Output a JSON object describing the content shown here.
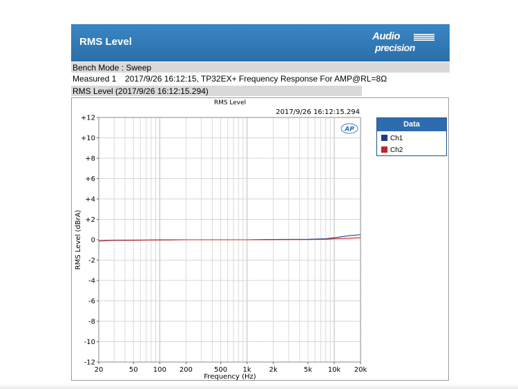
{
  "header": {
    "title": "RMS Level",
    "logo_top": "Audio",
    "logo_bottom": "precision"
  },
  "bench_mode": "Bench Mode : Sweep",
  "measured": {
    "label": "Measured 1",
    "text": "2017/9/26 16:12:15, TP32EX+ Frequency Response For AMP@RL=8Ω"
  },
  "rms_row": "RMS Level (2017/9/26 16:12:15.294)",
  "legend": {
    "title": "Data",
    "items": [
      "Ch1",
      "Ch2"
    ]
  },
  "colors": {
    "header_blue": "#2b6fa8",
    "ch1": "#1f3a8a",
    "ch2": "#c0242a",
    "grid": "#cfcfcf"
  },
  "chart_data": {
    "type": "line",
    "title": "RMS Level",
    "subtitle": "2017/9/26 16:12:15.294",
    "xlabel": "Frequency (Hz)",
    "ylabel": "RMS Level (dBrA)",
    "x_scale": "log",
    "xlim": [
      20,
      20000
    ],
    "ylim": [
      -12,
      12
    ],
    "grid": true,
    "x_ticks": [
      {
        "value": 20,
        "label": "20"
      },
      {
        "value": 50,
        "label": "50"
      },
      {
        "value": 100,
        "label": "100"
      },
      {
        "value": 200,
        "label": "200"
      },
      {
        "value": 500,
        "label": "500"
      },
      {
        "value": 1000,
        "label": "1k"
      },
      {
        "value": 2000,
        "label": "2k"
      },
      {
        "value": 5000,
        "label": "5k"
      },
      {
        "value": 10000,
        "label": "10k"
      },
      {
        "value": 20000,
        "label": "20k"
      }
    ],
    "y_ticks": [
      {
        "value": 12,
        "label": "+12"
      },
      {
        "value": 10,
        "label": "+10"
      },
      {
        "value": 8,
        "label": "+8"
      },
      {
        "value": 6,
        "label": "+6"
      },
      {
        "value": 4,
        "label": "+4"
      },
      {
        "value": 2,
        "label": "+2"
      },
      {
        "value": 0,
        "label": "0"
      },
      {
        "value": -2,
        "label": "-2"
      },
      {
        "value": -4,
        "label": "-4"
      },
      {
        "value": -6,
        "label": "-6"
      },
      {
        "value": -8,
        "label": "-8"
      },
      {
        "value": -10,
        "label": "-10"
      },
      {
        "value": -12,
        "label": "-12"
      }
    ],
    "series": [
      {
        "name": "Ch1",
        "color": "#1f3a8a",
        "x": [
          20,
          30,
          50,
          100,
          200,
          500,
          1000,
          2000,
          5000,
          8000,
          10000,
          15000,
          20000
        ],
        "y": [
          -0.12,
          -0.06,
          -0.05,
          -0.02,
          0.0,
          0.0,
          0.0,
          0.03,
          0.05,
          0.1,
          0.2,
          0.4,
          0.5
        ]
      },
      {
        "name": "Ch2",
        "color": "#c0242a",
        "x": [
          20,
          30,
          50,
          100,
          200,
          500,
          1000,
          2000,
          5000,
          8000,
          10000,
          15000,
          20000
        ],
        "y": [
          -0.1,
          -0.05,
          -0.04,
          -0.02,
          0.0,
          0.0,
          0.0,
          0.01,
          0.02,
          0.05,
          0.1,
          0.15,
          0.2
        ]
      }
    ]
  }
}
